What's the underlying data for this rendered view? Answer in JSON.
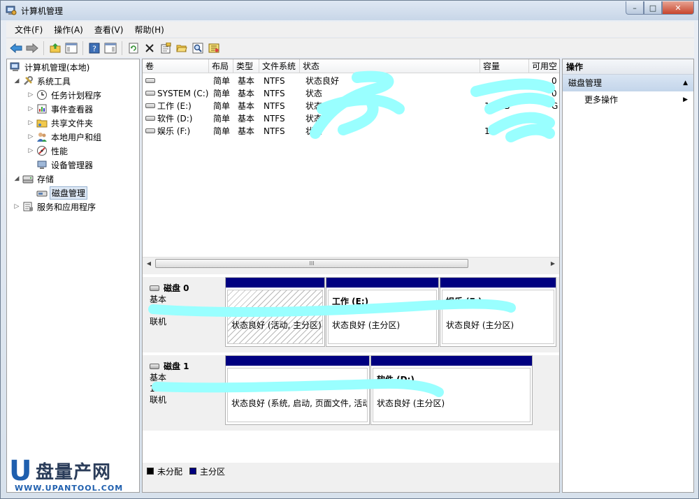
{
  "window": {
    "title": "计算机管理",
    "buttons": {
      "minimize": "–",
      "maximize": "□",
      "close": "✕"
    }
  },
  "menubar": [
    "文件(F)",
    "操作(A)",
    "查看(V)",
    "帮助(H)"
  ],
  "tree": {
    "root": "计算机管理(本地)",
    "system_tools": "系统工具",
    "task_scheduler": "任务计划程序",
    "event_viewer": "事件查看器",
    "shared_folders": "共享文件夹",
    "local_users": "本地用户和组",
    "performance": "性能",
    "device_manager": "设备管理器",
    "storage": "存储",
    "disk_management": "磁盘管理",
    "services_apps": "服务和应用程序"
  },
  "volume_list": {
    "columns": [
      "卷",
      "布局",
      "类型",
      "文件系统",
      "状态",
      "容量",
      "可用空"
    ],
    "rows": [
      {
        "volume": "",
        "layout": "简单",
        "type": "基本",
        "fs": "NTFS",
        "status": "状态良好",
        "capacity": "",
        "free": "0"
      },
      {
        "volume": "SYSTEM (C:)",
        "layout": "简单",
        "type": "基本",
        "fs": "NTFS",
        "status": "状态",
        "capacity": "",
        "free": "0"
      },
      {
        "volume": "工作 (E:)",
        "layout": "简单",
        "type": "基本",
        "fs": "NTFS",
        "status": "状态良",
        "capacity": "12    GB",
        "free": "G"
      },
      {
        "volume": "软件 (D:)",
        "layout": "简单",
        "type": "基本",
        "fs": "NTFS",
        "status": "状态良",
        "capacity": "",
        "free": ""
      },
      {
        "volume": "娱乐 (F:)",
        "layout": "简单",
        "type": "基本",
        "fs": "NTFS",
        "status": "状态",
        "capacity": "14",
        "free": ""
      }
    ],
    "scroll_thumb": "III"
  },
  "disks": [
    {
      "name": "磁盘 0",
      "type": "基本",
      "size": "",
      "state": "联机",
      "partitions": [
        {
          "name": "",
          "status": "状态良好 (活动, 主分区)",
          "hatched": true
        },
        {
          "name": "工作 (E:)",
          "status": "状态良好 (主分区)",
          "hatched": false
        },
        {
          "name": "娱乐 (F:)",
          "status": "状态良好 (主分区)",
          "hatched": false
        }
      ]
    },
    {
      "name": "磁盘 1",
      "type": "基本",
      "size": "12      GB",
      "state": "联机",
      "partitions": [
        {
          "name": "",
          "status": "状态良好 (系统, 启动, 页面文件, 活动",
          "hatched": false
        },
        {
          "name": "软件 (D:)",
          "status": "状态良好 (主分区)",
          "hatched": false
        }
      ]
    }
  ],
  "legend": {
    "unallocated": "未分配",
    "primary": "主分区"
  },
  "actions": {
    "header": "操作",
    "section": "磁盘管理",
    "more": "更多操作"
  },
  "watermark": {
    "letter": "U",
    "name": "盘量产网",
    "url": "WWW.UPANTOOL.COM"
  },
  "colors": {
    "partition_header": "#000080",
    "unallocated": "#000000",
    "scribble": "#99ffff"
  },
  "icons": [
    "computer-management-icon",
    "back-arrow-icon",
    "forward-arrow-icon",
    "up-folder-icon",
    "console-tree-icon",
    "help-icon",
    "refresh-icon",
    "delete-icon",
    "properties-icon",
    "open-folder-icon",
    "search-icon",
    "export-icon"
  ]
}
